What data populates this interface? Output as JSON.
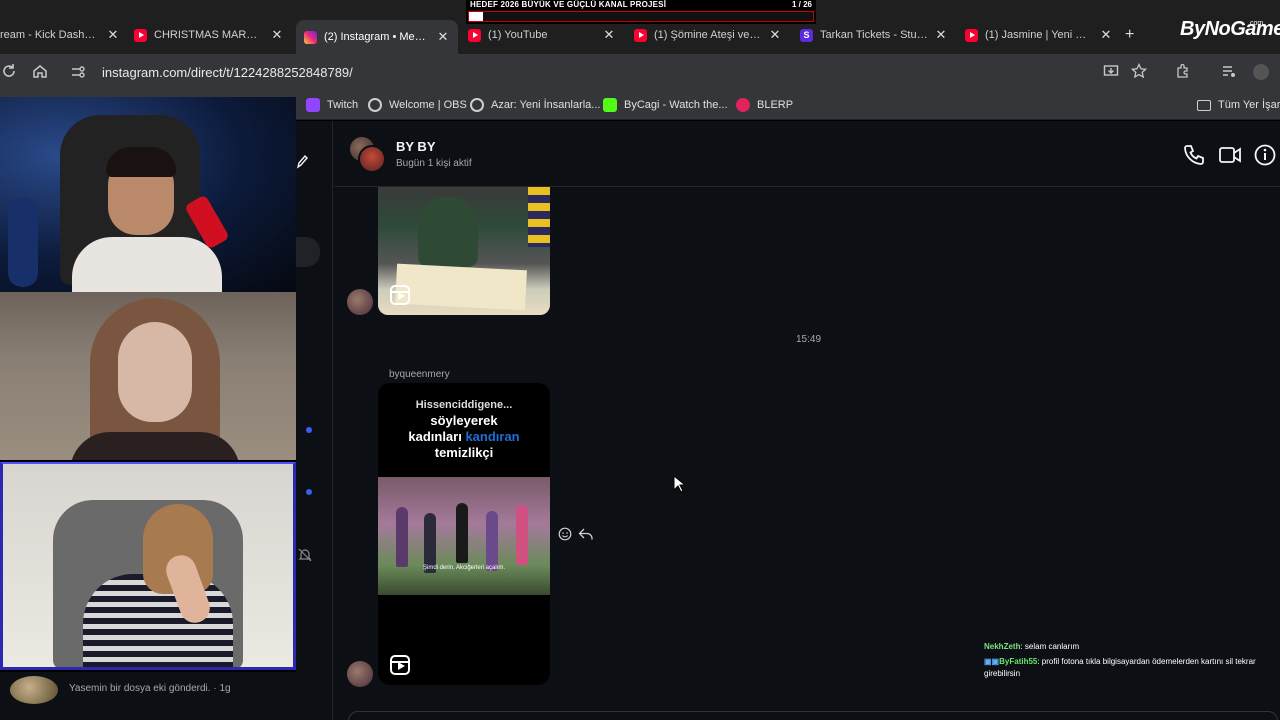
{
  "browser": {
    "tabs": [
      {
        "label": "ream - Kick Dashboa",
        "icon": "kick-icon"
      },
      {
        "label": "CHRISTMAS MARKET",
        "icon": "youtube-icon"
      },
      {
        "label": "(2) Instagram • Mesajla",
        "icon": "instagram-icon",
        "active": true
      },
      {
        "label": "(1) YouTube",
        "icon": "youtube-icon"
      },
      {
        "label": "(1) Şömine Ateşi ve Se",
        "icon": "youtube-icon"
      },
      {
        "label": "Tarkan Tickets - StubH",
        "icon": "stubhub-icon"
      },
      {
        "label": "(1) Jasmine | Yeni Dizi",
        "icon": "youtube-icon"
      }
    ],
    "new_tab": "+",
    "url": "instagram.com/direct/t/1224288252848789/",
    "bookmarks": [
      {
        "label": "Twitch",
        "color": "#9146ff"
      },
      {
        "label": "Welcome | OBS",
        "color": "#cfcfcf"
      },
      {
        "label": "Azar: Yeni İnsanlarla...",
        "color": "#cfcfcf"
      },
      {
        "label": "ByCagi - Watch the...",
        "color": "#53fc18"
      },
      {
        "label": "BLERP",
        "color": "#e0245e"
      }
    ],
    "bookmarks_folder": "Tüm Yer İşare"
  },
  "overlay": {
    "goal_title": "HEDEF 2026 BÜYÜK VE GÜÇLÜ KANAL PROJESİ",
    "goal_count": "1 / 26",
    "goal_progress": 0.04,
    "brand": "ByNoGame",
    "brand_sub": ".com",
    "chat": [
      {
        "user": "NekhZeth",
        "text": ": selam canlarım"
      },
      {
        "user": "ByFatih55",
        "text": ": profil fotona tıkla bilgisayardan ödemelerden kartını sil tekrar girebilirsin"
      }
    ]
  },
  "chat": {
    "name": "BY BY",
    "status": "Bugün 1 kişi aktif",
    "timestamp": "15:49",
    "sender": "byqueenmery",
    "reel_caption_line1": "Hissenciddigene...",
    "reel_caption_line2": "söyleyerek",
    "reel_caption_line3a": "kadınları ",
    "reel_caption_line3b": "kandıran",
    "reel_caption_line4": "temizlikçi",
    "reel_subtitle": "Şimdi derin. Akciğerleri açalım.",
    "notification": "Yasemin bir dosya eki gönderdi. · 1g"
  },
  "colors": {
    "ig_bg": "#0c1014",
    "accent": "#1d6fd6",
    "unread_dot": "#3a5ef0"
  }
}
